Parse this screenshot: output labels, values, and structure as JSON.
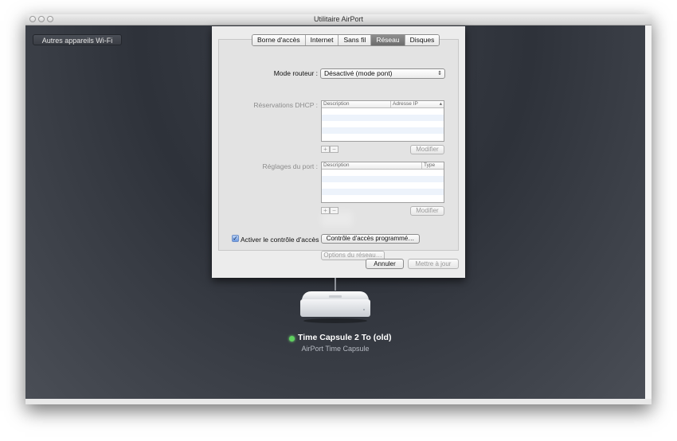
{
  "window": {
    "title": "Utilitaire AirPort"
  },
  "sidebar": {
    "other_wifi_label": "Autres appareils Wi-Fi"
  },
  "tabs": [
    {
      "label": "Borne d'accès",
      "active": false
    },
    {
      "label": "Internet",
      "active": false
    },
    {
      "label": "Sans fil",
      "active": false
    },
    {
      "label": "Réseau",
      "active": true
    },
    {
      "label": "Disques",
      "active": false
    }
  ],
  "router_mode": {
    "label": "Mode routeur :",
    "value": "Désactivé (mode pont)"
  },
  "dhcp": {
    "label": "Réservations DHCP :",
    "columns": [
      "Description",
      "Adresse IP"
    ],
    "add": "+",
    "remove": "−",
    "edit": "Modifier"
  },
  "ports": {
    "label": "Réglages du port :",
    "columns": [
      "Description",
      "Type"
    ],
    "add": "+",
    "remove": "−",
    "edit": "Modifier"
  },
  "access_control": {
    "checkbox_label": "Activer le contrôle d'accès :",
    "checked": true,
    "button": "Contrôle d'accès programmé…"
  },
  "network_options": "Options du réseau…",
  "footer": {
    "cancel": "Annuler",
    "update": "Mettre à jour"
  },
  "device": {
    "name": "Time Capsule 2 To (old)",
    "model": "AirPort Time Capsule",
    "status_color": "#5fd15f"
  },
  "colors": {
    "background": "#2e323a",
    "selected_tab": "#7a7a7a"
  }
}
